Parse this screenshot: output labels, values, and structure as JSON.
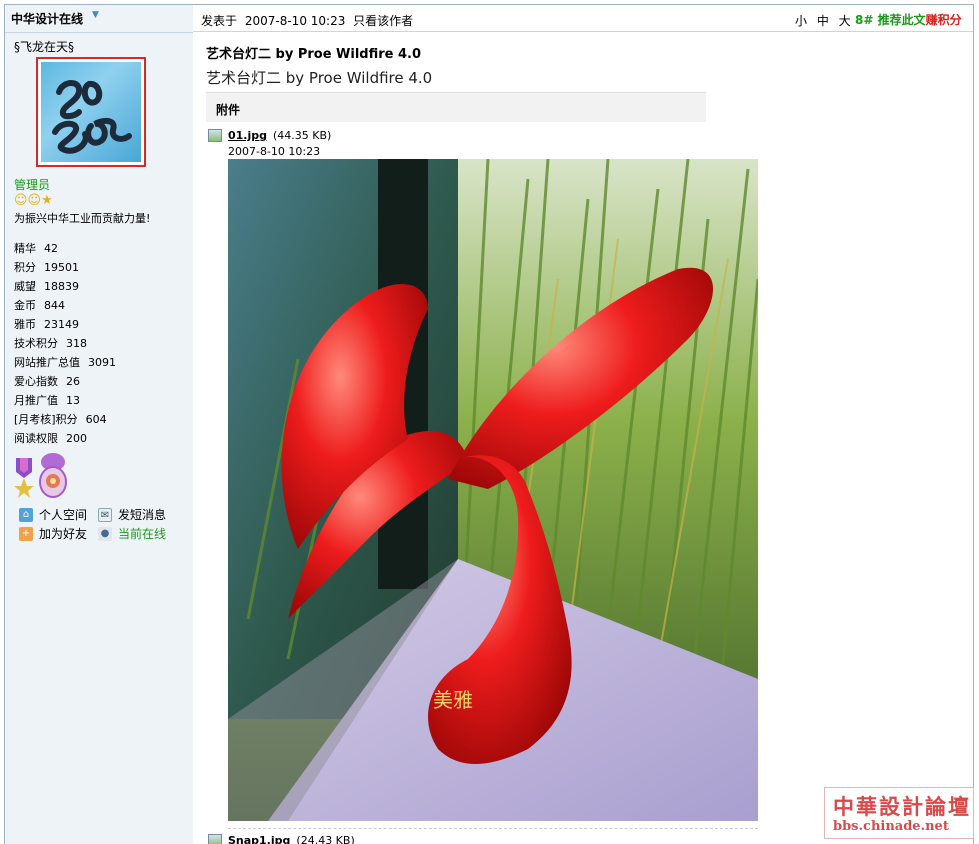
{
  "sidebar": {
    "forum_name": "中华设计在线",
    "username": "§飞龙在天§",
    "role": "管理员",
    "motto": "为振兴中华工业而贡献力量!",
    "stats": [
      {
        "key": "精华",
        "value": "42"
      },
      {
        "key": "积分",
        "value": "19501"
      },
      {
        "key": "威望",
        "value": "18839"
      },
      {
        "key": "金币",
        "value": "844"
      },
      {
        "key": "雅币",
        "value": "23149"
      },
      {
        "key": "技术积分",
        "value": "318"
      },
      {
        "key": "网站推广总值",
        "value": "3091"
      },
      {
        "key": "爱心指数",
        "value": "26"
      },
      {
        "key": "月推广值",
        "value": "13"
      },
      {
        "key": "[月考核]积分",
        "value": "604"
      },
      {
        "key": "阅读权限",
        "value": "200"
      }
    ],
    "actions": {
      "space": "个人空间",
      "message": "发短消息",
      "add_friend": "加为好友",
      "online": "当前在线"
    }
  },
  "post": {
    "posted_label": "发表于",
    "posted_time": "2007-8-10 10:23",
    "only_author": "只看该作者",
    "sizes": "小 中 大",
    "floor": "8#",
    "recommend": "推荐此文",
    "points": "赚积分",
    "title": "艺术台灯二  by Proe Wildfire 4.0",
    "subtitle": "艺术台灯二  by Proe Wildfire 4.0",
    "attachment_label": "附件",
    "file1": {
      "name": "01.jpg",
      "size": "(44.35 KB)",
      "date": "2007-8-10 10:23"
    },
    "file2": {
      "name": "Snap1.jpg",
      "size": "(24.43 KB)"
    },
    "photo_caption": "美雅"
  },
  "watermark": {
    "title": "中華設計論壇",
    "url": "bbs.chinade.net"
  }
}
